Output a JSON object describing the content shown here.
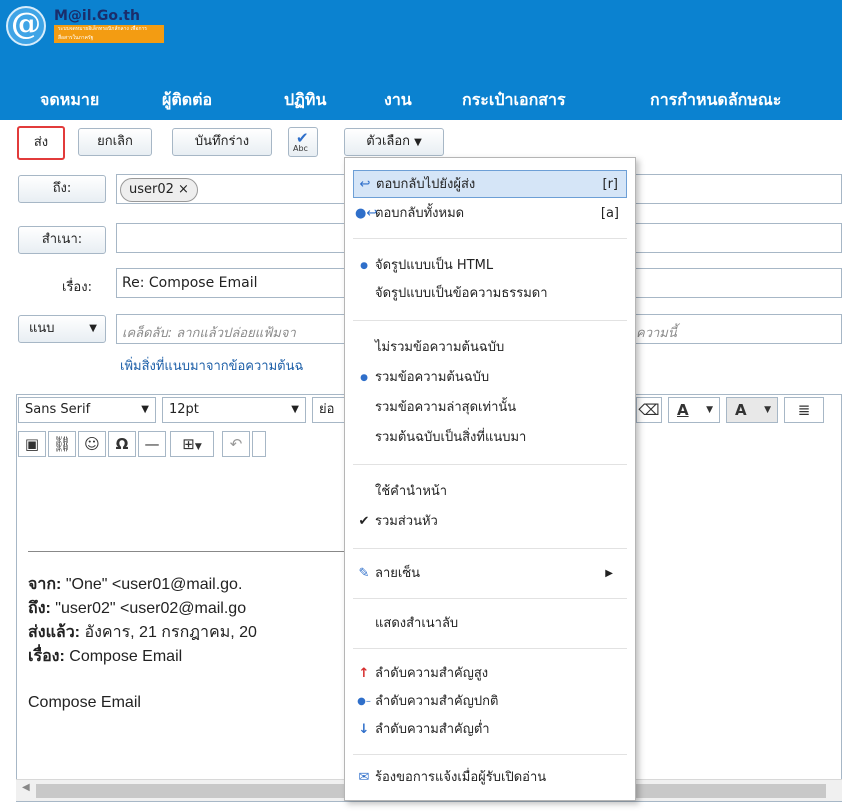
{
  "header": {
    "logo_name": "M@il.Go.th",
    "logo_sub": "ระบบจดหมายอิเล็กทรอนิกส์กลาง เพื่อการสื่อสารในภาครัฐ",
    "nav": [
      "จดหมาย",
      "ผู้ติดต่อ",
      "ปฏิทิน",
      "งาน",
      "กระเป๋าเอกสาร",
      "การกำหนดลักษณะ"
    ]
  },
  "toolbar": {
    "send": "ส่ง",
    "cancel": "ยกเลิก",
    "save_draft": "บันทึกร่าง",
    "spell_label": "Abc",
    "options": "ตัวเลือก"
  },
  "form": {
    "to_label": "ถึง:",
    "to_chip": "user02 ×",
    "cc_label": "สำเนา:",
    "subject_label": "เรื่อง:",
    "subject_value": "Re: Compose Email",
    "attach_label": "แนบ",
    "attach_placeholder": "เคล็ดลับ: ลากแล้วปล่อยแฟ้มจา",
    "attach_placeholder_right": "ความนี้",
    "add_attach_link": "เพิ่มสิ่งที่แนบมาจากข้อความต้นฉ"
  },
  "editor": {
    "font": "Sans Serif",
    "size": "12pt",
    "para_partial": "ย่อ",
    "quote": {
      "from_label": "จาก:",
      "from_value": " \"One\" <user01@mail.go.",
      "to_label": "ถึง:",
      "to_value": " \"user02\" <user02@mail.go",
      "sent_label": "ส่งแล้ว:",
      "sent_value": " อังคาร, 21 กรกฎาคม, 20",
      "subject_label": "เรื่อง:",
      "subject_value": " Compose Email",
      "body": "Compose Email"
    }
  },
  "menu": {
    "reply": "ตอบกลับไปยังผู้ส่ง",
    "reply_sc": "[r]",
    "reply_all": "ตอบกลับทั้งหมด",
    "reply_all_sc": "[a]",
    "html": "จัดรูปแบบเป็น HTML",
    "plain": "จัดรูปแบบเป็นข้อความธรรมดา",
    "no_orig": "ไม่รวมข้อความต้นฉบับ",
    "incl_orig": "รวมข้อความต้นฉบับ",
    "last_only": "รวมข้อความล่าสุดเท่านั้น",
    "orig_attach": "รวมต้นฉบับเป็นสิ่งที่แนบมา",
    "prefix": "ใช้คำนำหน้า",
    "headers": "รวมส่วนหัว",
    "signature": "ลายเซ็น",
    "show_bcc": "แสดงสำเนาลับ",
    "prio_high": "ลำดับความสำคัญสูง",
    "prio_normal": "ลำดับความสำคัญปกติ",
    "prio_low": "ลำดับความสำคัญต่ำ",
    "read_receipt": "ร้องขอการแจ้งเมื่อผู้รับเปิดอ่าน"
  },
  "colors": {
    "header_blue": "#0b82d0",
    "send_highlight": "#e23b3b",
    "menu_highlight": "#d5e5f7"
  }
}
